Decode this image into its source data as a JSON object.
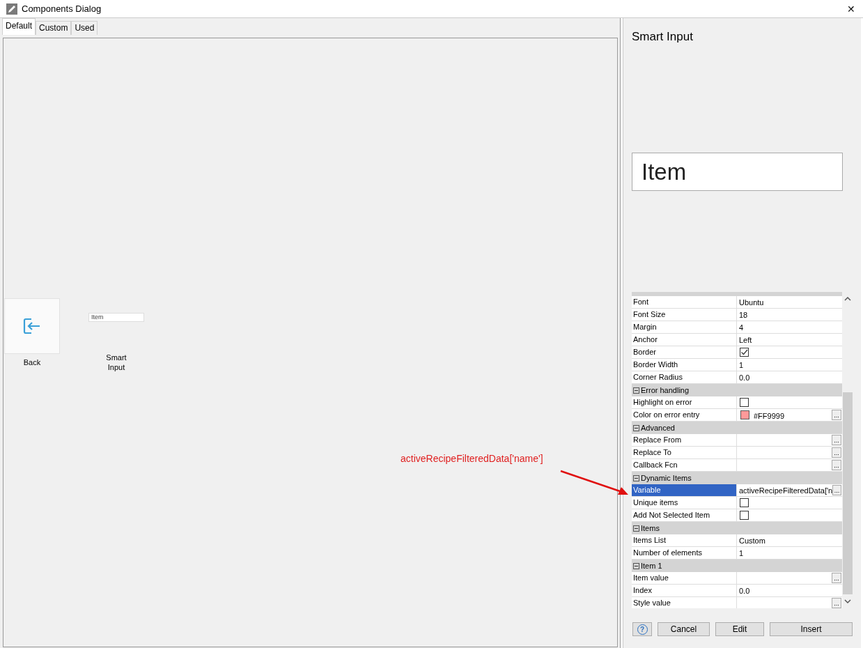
{
  "window": {
    "title": "Components Dialog",
    "close": "✕"
  },
  "tabs": [
    {
      "label": "Default",
      "selected": true
    },
    {
      "label": "Custom",
      "selected": false
    },
    {
      "label": "Used",
      "selected": false
    }
  ],
  "components": [
    {
      "label": "Back",
      "kind": "icon-tile"
    },
    {
      "label": "Smart Input",
      "kind": "input-preview",
      "preview": "Item"
    }
  ],
  "annotation": {
    "text": "activeRecipeFilteredData['name']"
  },
  "preview_panel": {
    "title": "Smart Input",
    "preview_text": "Item"
  },
  "properties": [
    {
      "kind": "text",
      "name": "Font",
      "value": "Ubuntu"
    },
    {
      "kind": "text",
      "name": "Font Size",
      "value": "18"
    },
    {
      "kind": "text",
      "name": "Margin",
      "value": "4"
    },
    {
      "kind": "text",
      "name": "Anchor",
      "value": "Left"
    },
    {
      "kind": "check",
      "name": "Border",
      "checked": true
    },
    {
      "kind": "text",
      "name": "Border Width",
      "value": "1"
    },
    {
      "kind": "text",
      "name": "Corner Radius",
      "value": "0.0"
    },
    {
      "kind": "section",
      "name": "Error handling",
      "expanded": true
    },
    {
      "kind": "check",
      "name": "Highlight on error",
      "checked": false
    },
    {
      "kind": "color",
      "name": "Color on error entry",
      "value": "#FF9999",
      "color": "#ff9999",
      "button": "..."
    },
    {
      "kind": "section",
      "name": "Advanced",
      "expanded": true
    },
    {
      "kind": "text",
      "name": "Replace From",
      "button": "..."
    },
    {
      "kind": "text",
      "name": "Replace To",
      "button": "..."
    },
    {
      "kind": "text",
      "name": "Callback Fcn",
      "button": "..."
    },
    {
      "kind": "section",
      "name": "Dynamic Items",
      "expanded": true
    },
    {
      "kind": "text",
      "name": "Variable",
      "value": "activeRecipeFilteredData['n",
      "button": "...",
      "selected": true
    },
    {
      "kind": "check",
      "name": "Unique items",
      "checked": false
    },
    {
      "kind": "check",
      "name": "Add Not Selected Item",
      "checked": false
    },
    {
      "kind": "section",
      "name": "Items",
      "expanded": true
    },
    {
      "kind": "text",
      "name": "Items List",
      "value": "Custom"
    },
    {
      "kind": "text",
      "name": "Number of elements",
      "value": "1"
    },
    {
      "kind": "section",
      "name": "Item 1",
      "expanded": true
    },
    {
      "kind": "text",
      "name": "Item value",
      "button": "..."
    },
    {
      "kind": "text",
      "name": "Index",
      "value": "0.0"
    },
    {
      "kind": "text",
      "name": "Style value",
      "button": "..."
    }
  ],
  "buttons": [
    {
      "kind": "help",
      "label": "?"
    },
    {
      "kind": "text",
      "label": "Cancel"
    },
    {
      "kind": "text",
      "label": "Edit"
    },
    {
      "kind": "text",
      "label": "Insert"
    }
  ]
}
